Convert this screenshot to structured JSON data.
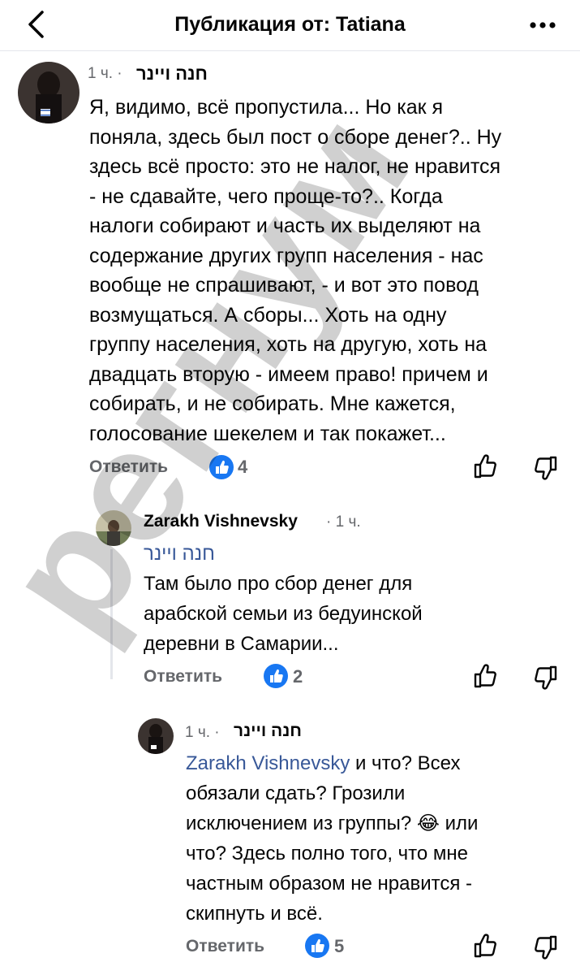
{
  "header": {
    "title": "Публикация от: Tatiana"
  },
  "comments": [
    {
      "author": "חנה ויינר",
      "time": "1 ч.",
      "text_lines": [
        "Я, видимо, всё пропустила... Но как я",
        "поняла, здесь был пост о сборе денег?.. Ну",
        "здесь всё просто: это не налог, не нравится",
        "- не сдавайте, чего проще-то?.. Когда",
        "налоги собирают и часть их выделяют на",
        "содержание других групп населения - нас",
        "вообще не спрашивают, - и вот это повод",
        "возмущаться. А сборы... Хоть на одну",
        "группу населения, хоть на другую, хоть на",
        "двадцать вторую - имеем право! причем и",
        "собирать, и не собирать. Мне кажется,",
        "голосование шекелем и так покажет..."
      ],
      "reply_label": "Ответить",
      "reactions": "4"
    },
    {
      "author": "Zarakh Vishnevsky",
      "time": "1 ч.",
      "mention": "חנה ויינר",
      "text_lines": [
        "Там было про сбор денег для",
        "арабской семьи из бедуинской",
        "деревни в Самарии..."
      ],
      "reply_label": "Ответить",
      "reactions": "2"
    },
    {
      "author": "חנה ויינר",
      "time": "1 ч.",
      "mention": "Zarakh Vishnevsky",
      "first_line_rest": "и что? Всех",
      "line2": "обязали сдать? Грозили",
      "line3_a": "исключением из группы?",
      "emoji": "😂",
      "line3_b": "или",
      "line4": "что? Здесь полно того, что мне",
      "line5": "частным образом не нравится -",
      "line6": "скипнуть и всё.",
      "reply_label": "Ответить",
      "reactions": "5"
    }
  ],
  "watermark": "регнум",
  "colors": {
    "accent": "#1877f2",
    "mention": "#385898",
    "muted": "#65676b"
  },
  "icons": [
    "back-chevron-icon",
    "more-dots-icon",
    "like-icon",
    "dislike-icon",
    "thumbs-up-reaction-icon"
  ]
}
